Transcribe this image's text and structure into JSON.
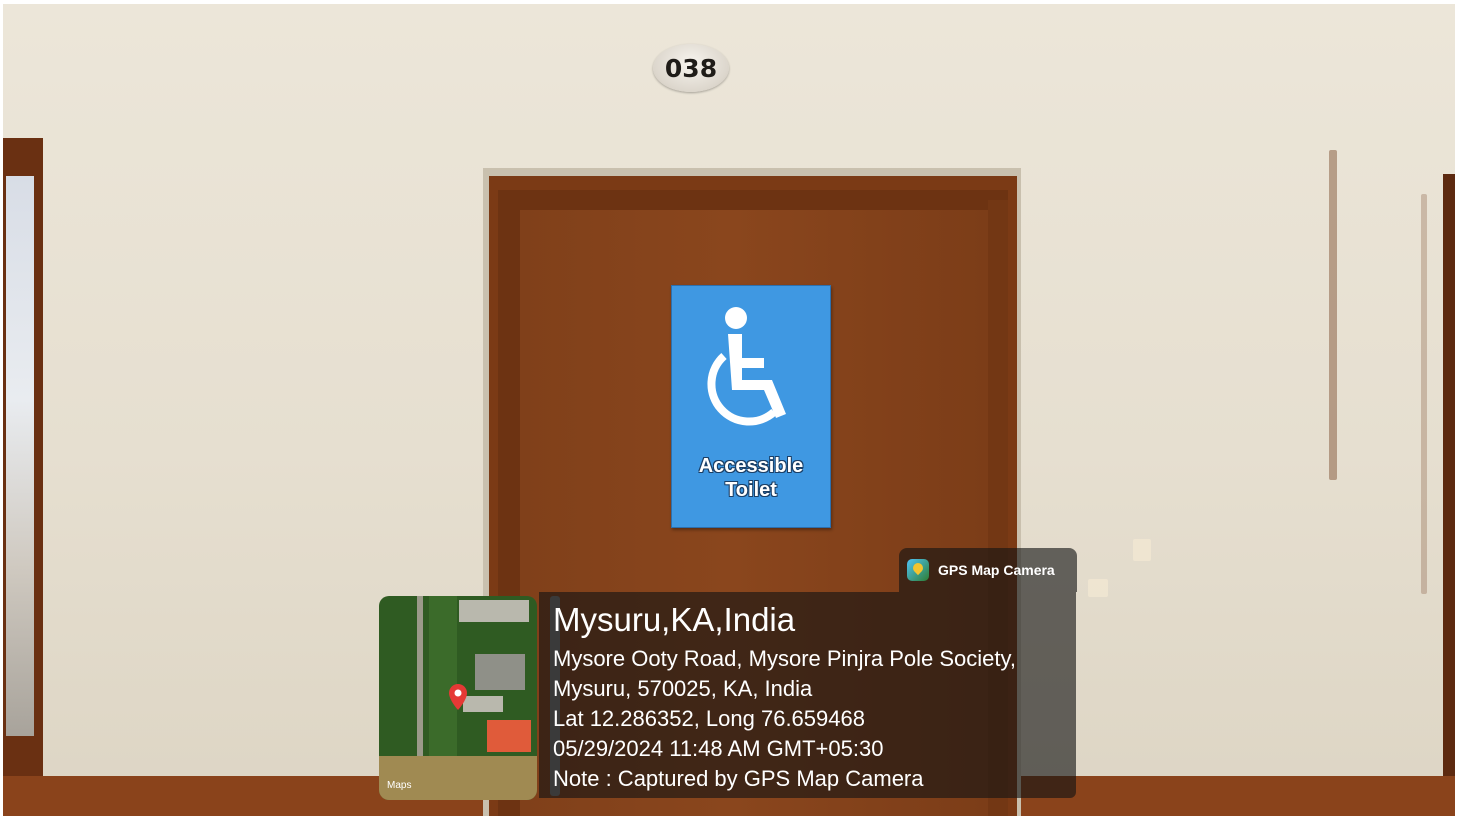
{
  "photo": {
    "room_number": "038",
    "sign": {
      "icon": "wheelchair-icon",
      "line1": "Accessible",
      "line2": "Toilet",
      "color": "#3f98e2"
    }
  },
  "overlay": {
    "brand_icon": "gps-map-camera-icon",
    "brand": "GPS Map Camera",
    "map_icon": "location-pin-icon",
    "map_credit": "Maps",
    "title": "Mysuru,KA,India",
    "address_line1": "Mysore Ooty Road, Mysore Pinjra Pole Society,",
    "address_line2": "Mysuru, 570025, KA, India",
    "coordinates": "Lat 12.286352, Long 76.659468",
    "datetime": "05/29/2024 11:48 AM GMT+05:30",
    "note": "Note : Captured by GPS Map Camera"
  }
}
